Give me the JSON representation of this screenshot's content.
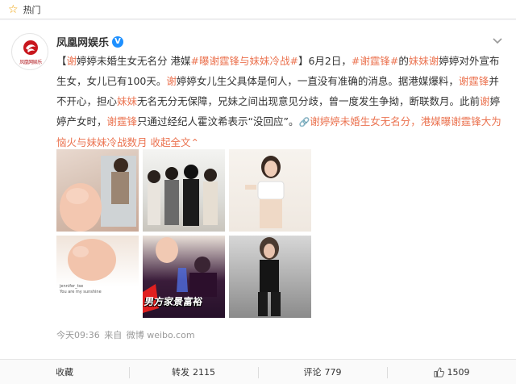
{
  "hot_bar": {
    "label": "热门"
  },
  "author": {
    "name": "凤凰网娱乐",
    "verified_badge": "V",
    "logo_text": "凤凰网娱乐"
  },
  "post": {
    "segments": [
      {
        "text": "【",
        "style": "n"
      },
      {
        "text": "谢",
        "style": "h"
      },
      {
        "text": "婷婷未婚生女无名分 港媒",
        "style": "n"
      },
      {
        "text": "#曝谢霆锋与妹妹冷战#",
        "style": "h"
      },
      {
        "text": "】6月2日，",
        "style": "n"
      },
      {
        "text": "#谢霆锋#",
        "style": "h"
      },
      {
        "text": "的",
        "style": "n"
      },
      {
        "text": "妹妹谢",
        "style": "h"
      },
      {
        "text": "婷婷对外宣布生女，女儿已有100天。",
        "style": "n"
      },
      {
        "text": "谢",
        "style": "h"
      },
      {
        "text": "婷婷女儿生父具体是何人，一直没有准确的消息。据港媒爆料，",
        "style": "n"
      },
      {
        "text": "谢霆锋",
        "style": "h"
      },
      {
        "text": "并不开心，担心",
        "style": "n"
      },
      {
        "text": "妹妹",
        "style": "h"
      },
      {
        "text": "无名无分无保障，兄妹之间出现意见分歧，曾一度发生争拗，断联数月。此前",
        "style": "n"
      },
      {
        "text": "谢",
        "style": "h"
      },
      {
        "text": "婷婷产女时，",
        "style": "n"
      },
      {
        "text": "谢霆锋",
        "style": "h"
      },
      {
        "text": "只通过经纪人霍汶希表示“没回应”。",
        "style": "n"
      },
      {
        "text": "🔗",
        "style": "i"
      },
      {
        "text": "谢婷婷未婚生女无名分，港媒曝谢霆锋大为恼火与妹妹冷战数月",
        "style": "l"
      },
      {
        "text": " 收起全文",
        "style": "l"
      },
      {
        "text": "⌃",
        "style": "l"
      }
    ]
  },
  "images": {
    "t4_caption": "jennifer_tse\nYou are my sunshine",
    "t5_caption": "男方家景富裕"
  },
  "meta": {
    "time": "今天09:36",
    "from_label": "来自",
    "source": "微博 weibo.com"
  },
  "actions": {
    "collect": "收藏",
    "repost_label": "转发",
    "repost_count": "2115",
    "comment_label": "评论",
    "comment_count": "779",
    "like_count": "1509"
  },
  "colors": {
    "highlight": "#eb7350",
    "verified": "#1e90ff",
    "hot_star": "#f0a000"
  }
}
